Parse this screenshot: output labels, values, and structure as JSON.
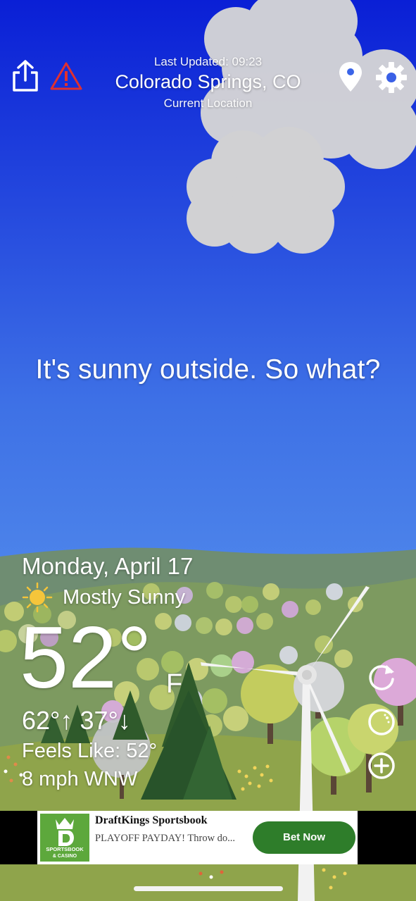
{
  "header": {
    "last_updated": "Last Updated: 09:23",
    "location": "Colorado Springs, CO",
    "location_sub": "Current Location",
    "icons": [
      "share-icon",
      "alert-triangle-icon",
      "map-pin-icon",
      "gear-icon"
    ]
  },
  "tagline": "It's sunny outside. So what?",
  "weather": {
    "date": "Monday, April 17",
    "condition": "Mostly Sunny",
    "condition_icon": "sun-icon",
    "temperature": "52°",
    "unit": "F",
    "hilo": "62°↑  37°↓",
    "feels_like": "Feels Like: 52°",
    "wind": "8 mph WNW"
  },
  "controls": {
    "icons": [
      "refresh-icon",
      "moon-icon",
      "add-circle-icon"
    ]
  },
  "ad": {
    "title": "DraftKings Sportsbook",
    "body": "PLAYOFF PAYDAY! Throw do...",
    "cta": "Bet Now",
    "logo_line1": "SPORTSBOOK",
    "logo_line2": "& CASINO",
    "brand_color": "#5da83c",
    "cta_color": "#2e7d2a"
  },
  "colors": {
    "sky_top": "#0a1fd6",
    "sky_bottom": "#6aa9f1",
    "hills": "#6f8f6d",
    "grass": "#8fa44b",
    "alert": "#e03030"
  }
}
